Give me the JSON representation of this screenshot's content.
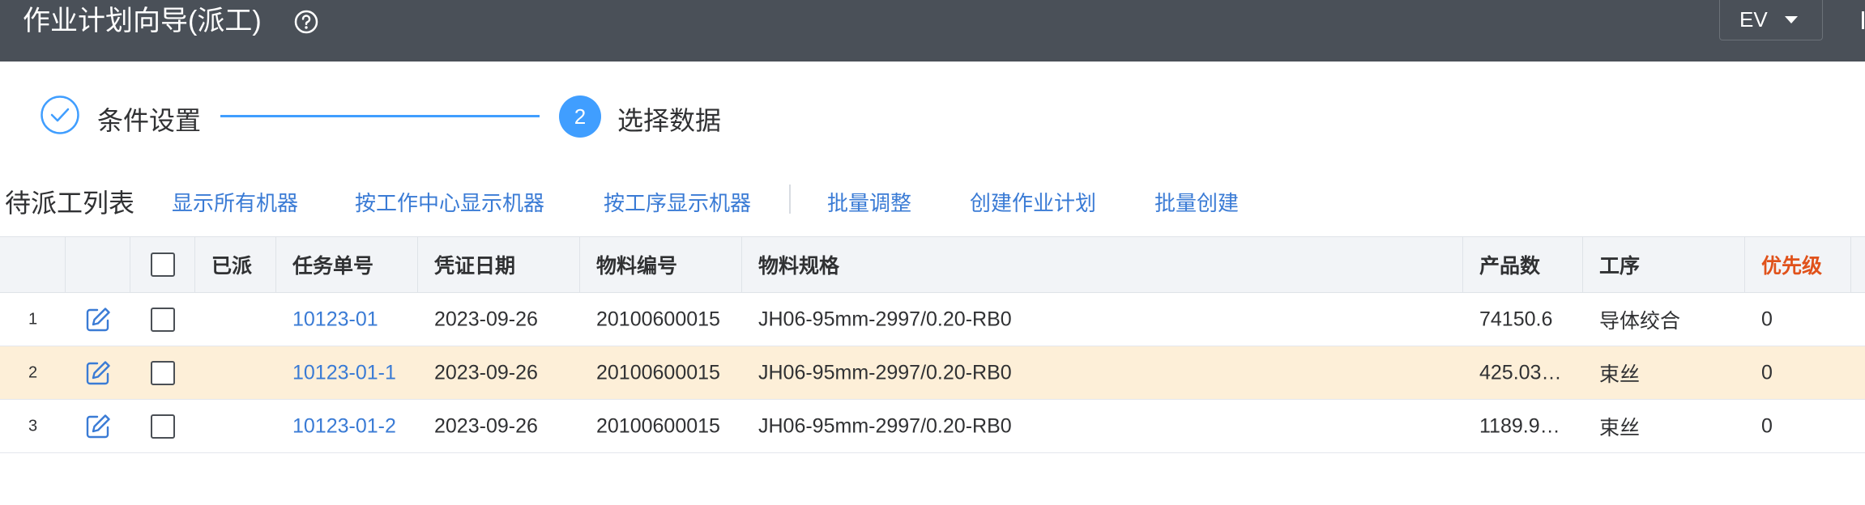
{
  "header": {
    "title": "作业计划向导(派工)",
    "lang_select_value": "EV"
  },
  "steps": [
    {
      "label": "条件设置",
      "status": "done"
    },
    {
      "label": "选择数据",
      "number": "2",
      "status": "active"
    }
  ],
  "toolbar": {
    "list_title": "待派工列表",
    "buttons": [
      "显示所有机器",
      "按工作中心显示机器",
      "按工序显示机器",
      "批量调整",
      "创建作业计划",
      "批量创建"
    ]
  },
  "table": {
    "columns": {
      "dispatched": "已派",
      "task_no": "任务单号",
      "voucher_date": "凭证日期",
      "material_code": "物料编号",
      "material_spec": "物料规格",
      "product_qty": "产品数",
      "process": "工序",
      "priority": "优先级"
    },
    "rows": [
      {
        "index": "1",
        "task_no": "10123-01",
        "voucher_date": "2023-09-26",
        "material_code": "20100600015",
        "material_spec": "JH06-95mm-2997/0.20-RB0",
        "product_qty": "74150.6",
        "process": "导体绞合",
        "priority": "0"
      },
      {
        "index": "2",
        "task_no": "10123-01-1",
        "voucher_date": "2023-09-26",
        "material_code": "20100600015",
        "material_spec": "JH06-95mm-2997/0.20-RB0",
        "product_qty": "425.03…",
        "process": "束丝",
        "priority": "0"
      },
      {
        "index": "3",
        "task_no": "10123-01-2",
        "voucher_date": "2023-09-26",
        "material_code": "20100600015",
        "material_spec": "JH06-95mm-2997/0.20-RB0",
        "product_qty": "1189.9…",
        "process": "束丝",
        "priority": "0"
      }
    ]
  },
  "colors": {
    "header_bg": "#4a5058",
    "accent": "#409eff",
    "link": "#3a7bd5",
    "highlight_row": "#fdefd8",
    "priority_header": "#e0521b"
  }
}
